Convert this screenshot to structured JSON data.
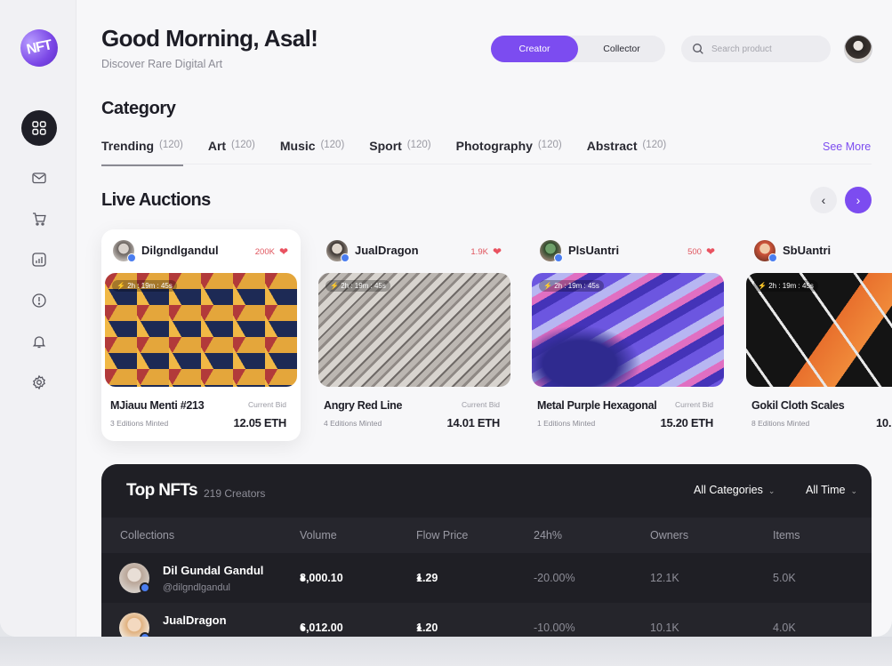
{
  "brand": {
    "logo_text": "NFT"
  },
  "header": {
    "greeting": "Good Morning, Asal!",
    "subtitle": "Discover Rare Digital Art",
    "toggle": {
      "creator": "Creator",
      "collector": "Collector",
      "selected": "Creator"
    },
    "search_placeholder": "Search product"
  },
  "sidebar": {
    "items": [
      {
        "icon": "grid-icon",
        "active": true
      },
      {
        "icon": "mail-icon",
        "active": false
      },
      {
        "icon": "cart-icon",
        "active": false
      },
      {
        "icon": "chart-icon",
        "active": false
      },
      {
        "icon": "info-icon",
        "active": false
      },
      {
        "icon": "bell-icon",
        "active": false
      },
      {
        "icon": "gear-icon",
        "active": false
      }
    ]
  },
  "category": {
    "title": "Category",
    "tabs": [
      {
        "label": "Trending",
        "count": "(120)"
      },
      {
        "label": "Art",
        "count": "(120)"
      },
      {
        "label": "Music",
        "count": "(120)"
      },
      {
        "label": "Sport",
        "count": "(120)"
      },
      {
        "label": "Photography",
        "count": "(120)"
      },
      {
        "label": "Abstract",
        "count": "(120)"
      }
    ],
    "see_more": "See More"
  },
  "auctions": {
    "title": "Live Auctions",
    "bid_label": "Current Bid",
    "cards": [
      {
        "owner": "Dilgndlgandul",
        "likes": "200K",
        "timer": "2h : 19m : 45s",
        "name": "MJiauu Menti #213",
        "minted": "3 Editions Minted",
        "bid": "12.05 ETH"
      },
      {
        "owner": "JualDragon",
        "likes": "1.9K",
        "timer": "2h : 19m : 45s",
        "name": "Angry Red Line",
        "minted": "4 Editions Minted",
        "bid": "14.01 ETH"
      },
      {
        "owner": "PlsUantri",
        "likes": "500",
        "timer": "2h : 19m : 45s",
        "name": "Metal Purple Hexagonal",
        "minted": "1 Editions Minted",
        "bid": "15.20 ETH"
      },
      {
        "owner": "SbUantri",
        "likes": "",
        "timer": "2h : 19m : 45s",
        "name": "Gokil Cloth Scales",
        "minted": "8 Editions Minted",
        "bid": "10."
      }
    ]
  },
  "top_nfts": {
    "title": "Top NFTs",
    "subtitle": "219 Creators",
    "filter_category": "All Categories",
    "filter_time": "All Time",
    "columns": [
      "Collections",
      "Volume",
      "Flow Price",
      "24h%",
      "Owners",
      "Items"
    ],
    "rows": [
      {
        "name": "Dil Gundal Gandul",
        "handle": "@dilgndlgandul",
        "volume": "8,000.10",
        "floor": "1.29",
        "change": "-20.00%",
        "owners": "12.1K",
        "items": "5.0K"
      },
      {
        "name": "JualDragon",
        "handle": "",
        "volume": "6,012.00",
        "floor": "1.20",
        "change": "-10.00%",
        "owners": "10.1K",
        "items": "4.0K"
      }
    ]
  }
}
